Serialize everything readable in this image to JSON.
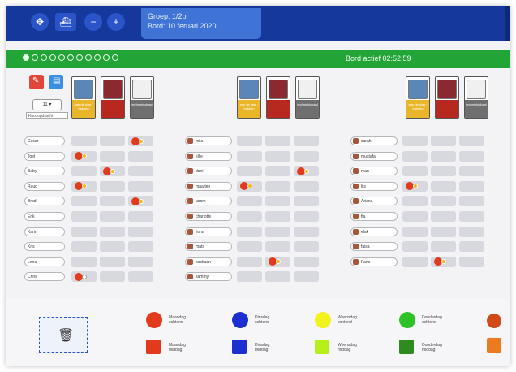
{
  "header": {
    "group_label": "Groep: 1/2b",
    "board_label": "Bord: 10 feruari 2020",
    "buttons": [
      {
        "icon": "resize-arrows-icon"
      },
      {
        "icon": "boat-icon"
      },
      {
        "icon": "minus-icon"
      },
      {
        "icon": "plus-icon"
      }
    ]
  },
  "status": {
    "board_active": "Bord actief 02:52:59",
    "progress_dots_total": 11,
    "progress_dots_filled": 1
  },
  "toolbar": {
    "counter_value": "11",
    "select_value": "Kies opdracht"
  },
  "activities": [
    {
      "caption": "aan de slag / bakken",
      "color": "#e9b62a"
    },
    {
      "caption": "",
      "color": "#b7281f"
    },
    {
      "caption": "technieklokaal",
      "color": "#6f6f6f"
    }
  ],
  "columns": [
    {
      "names": [
        "Cesar",
        "Joel",
        "Baby",
        "Ruud",
        "Brad",
        "Erik",
        "Karin",
        "Kris",
        "Lena",
        "Chris"
      ],
      "avatars": false
    },
    {
      "names": [
        "mila",
        "ellie",
        "dani",
        "maarten",
        "tamm",
        "charlotte",
        "fiona",
        "mats",
        "bastiaan",
        "sammy"
      ],
      "avatars": true
    },
    {
      "names": [
        "sarah",
        "mustafa",
        "ryan",
        "lijs",
        "Ariana",
        "fia",
        "elak",
        "faisa",
        "Fane"
      ],
      "avatars": true
    }
  ],
  "marks": [
    {
      "group": 0,
      "row": 0,
      "slot": 2,
      "tag": "yellow"
    },
    {
      "group": 0,
      "row": 1,
      "slot": 0,
      "tag": "yellow"
    },
    {
      "group": 0,
      "row": 2,
      "slot": 1,
      "tag": "yellow"
    },
    {
      "group": 0,
      "row": 3,
      "slot": 0,
      "tag": "yellow"
    },
    {
      "group": 0,
      "row": 4,
      "slot": 2,
      "tag": "yellow"
    },
    {
      "group": 0,
      "row": 9,
      "slot": 0,
      "tag": "white"
    },
    {
      "group": 1,
      "row": 2,
      "slot": 2,
      "tag": "yellow"
    },
    {
      "group": 1,
      "row": 3,
      "slot": 0,
      "tag": "yellow"
    },
    {
      "group": 1,
      "row": 8,
      "slot": 1,
      "tag": "yellow"
    },
    {
      "group": 2,
      "row": 3,
      "slot": 0,
      "tag": "yellow"
    },
    {
      "group": 2,
      "row": 8,
      "slot": 1,
      "tag": "yellow"
    }
  ],
  "legend": [
    {
      "shape": "circle",
      "color": "#e13a1c",
      "label": "Maandag ochtend"
    },
    {
      "shape": "circle",
      "color": "#1d2fd1",
      "label": "Dinsdag ochtend"
    },
    {
      "shape": "circle",
      "color": "#f2f21c",
      "label": "Woensdag ochtend"
    },
    {
      "shape": "circle",
      "color": "#2fc12a",
      "label": "Donderdag ochtend"
    },
    {
      "shape": "square",
      "color": "#e13a1c",
      "label": "Maandag middag"
    },
    {
      "shape": "square",
      "color": "#1d2fd1",
      "label": "Dinsdag middag"
    },
    {
      "shape": "square",
      "color": "#b6ef1c",
      "label": "Woensdag middag"
    },
    {
      "shape": "square",
      "color": "#2e8c1f",
      "label": "Donderdag middag"
    }
  ],
  "legend_extra_colors": [
    "#d2491a",
    "#ec7a1e"
  ],
  "trash": {
    "icon": "trash-icon"
  }
}
